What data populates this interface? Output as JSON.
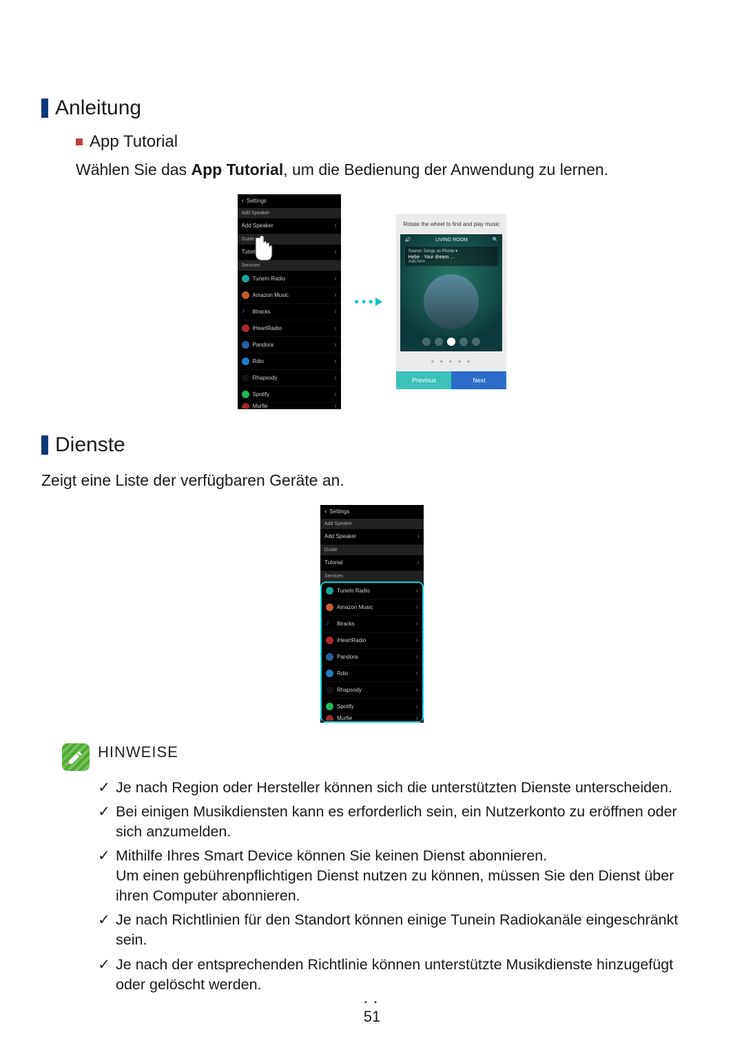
{
  "headings": {
    "h1_anleitung": "Anleitung",
    "h2_apptutorial": "App Tutorial",
    "h1_dienste": "Dienste"
  },
  "body": {
    "apptutorial_pre": "Wählen Sie das ",
    "apptutorial_bold": "App Tutorial",
    "apptutorial_post": ", um die Bedienung der Anwendung zu lernen.",
    "dienste_desc": "Zeigt eine Liste der verfügbaren Geräte an."
  },
  "screenshot1": {
    "header_back": "‹",
    "header_title": "Settings",
    "section_addspeaker": "Add Speaker",
    "row_addspeaker": "Add Speaker",
    "section_guide": "Guide",
    "row_tutorial": "Tutorial",
    "section_services": "Services",
    "services": [
      {
        "name": "TuneIn Radio",
        "color": "#17a79a"
      },
      {
        "name": "Amazon Music",
        "color": "#c85a2a"
      },
      {
        "name": "8tracks",
        "color": "#2b6fb4"
      },
      {
        "name": "iHeartRadio",
        "color": "#b3262a"
      },
      {
        "name": "Pandora",
        "color": "#2a5fa0"
      },
      {
        "name": "Rdio",
        "color": "#1e7fc6"
      },
      {
        "name": "Rhapsody",
        "color": "#111"
      },
      {
        "name": "Spotify",
        "color": "#1db954"
      },
      {
        "name": "Murfie",
        "color": "#a02a2a"
      }
    ]
  },
  "screenshot2": {
    "tip": "Rotate the wheel to find and play music",
    "room": "LIVING ROOM",
    "source": "Source: Songs on Phone ▾",
    "nowplaying": "Hebe · Your dream …",
    "add": "Add here",
    "prev": "Previous",
    "next": "Next"
  },
  "notes": {
    "title": "HINWEISE",
    "items": [
      "Je nach Region oder Hersteller können sich die unterstützten Dienste unterscheiden.",
      "Bei einigen Musikdiensten kann es erforderlich sein, ein Nutzerkonto zu eröffnen oder sich anzumelden.",
      "Mithilfe Ihres Smart Device können Sie keinen Dienst abonnieren.\nUm einen gebührenpflichtigen Dienst nutzen zu können, müssen Sie den Dienst über ihren Computer abonnieren.",
      "Je nach Richtlinien für den Standort können einige Tunein Radiokanäle eingeschränkt sein.",
      "Je nach der entsprechenden Richtlinie können unterstützte Musikdienste hinzugefügt oder gelöscht werden."
    ]
  },
  "page_number": "51"
}
